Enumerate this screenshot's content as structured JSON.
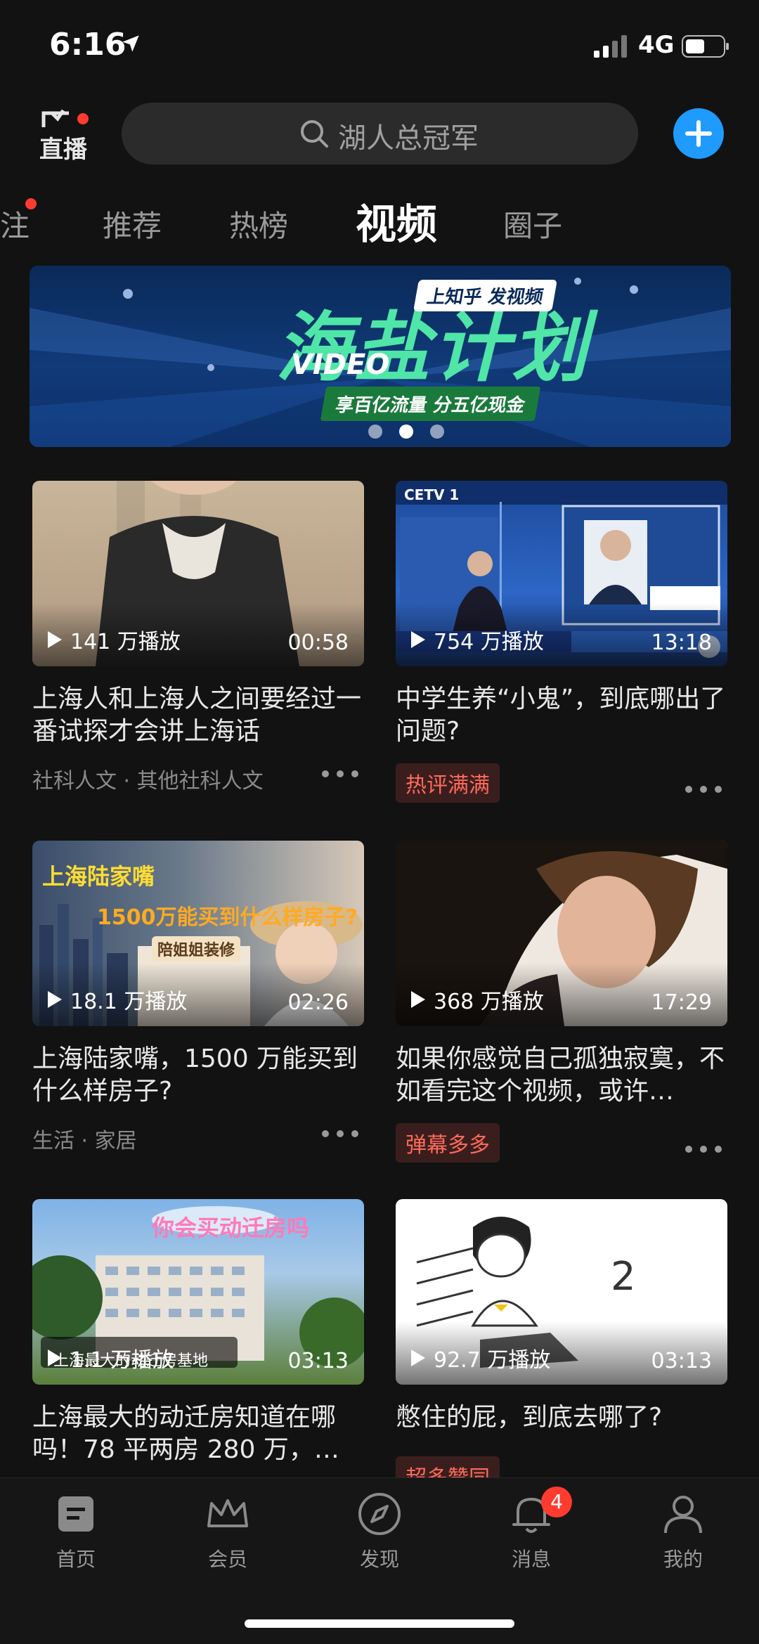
{
  "status_bar": {
    "time": "6:16",
    "network": "4G"
  },
  "header": {
    "live_label": "直播",
    "search_placeholder": "湖人总冠军"
  },
  "tabs": [
    {
      "label": "注",
      "dot": true
    },
    {
      "label": "推荐"
    },
    {
      "label": "热榜"
    },
    {
      "label": "视频",
      "active": true
    },
    {
      "label": "圈子"
    }
  ],
  "banner": {
    "title": "海盐计划",
    "video_text": "VIDEO",
    "tag": "上知乎 发视频",
    "subtitle": "享百亿流量  分五亿现金",
    "slide_index": 2,
    "slide_count": 3
  },
  "feed": [
    {
      "plays": "141 万播放",
      "duration": "00:58",
      "title": "上海人和上海人之间要经过一番试探才会讲上海话",
      "meta": "社科人文 · 其他社科人文"
    },
    {
      "plays": "754 万播放",
      "duration": "13:18",
      "title": "中学生养“小鬼”，到底哪出了问题?",
      "tag": "热评满满",
      "thumb_text": "CETV 1"
    },
    {
      "plays": "18.1 万播放",
      "duration": "02:26",
      "title": "上海陆家嘴，1500 万能买到什么样房子?",
      "meta": "生活 · 家居",
      "thumb_text": "上海陆家嘴",
      "thumb_text2": "1500万能买到什么样房子?",
      "thumb_text3": "陪姐姐装修"
    },
    {
      "plays": "368 万播放",
      "duration": "17:29",
      "title": "如果你感觉自己孤独寂寞，不如看完这个视频，或许…",
      "tag": "弹幕多多"
    },
    {
      "plays": "1.1 万播放",
      "duration": "03:13",
      "title": "上海最大的动迁房知道在哪吗！78 平两房 280 万，…",
      "thumb_text": "你会买动迁房吗",
      "thumb_text2": "上海最大的动迁房基地"
    },
    {
      "plays": "92.7 万播放",
      "duration": "03:13",
      "title": "憋住的屁，到底去哪了?",
      "tag": "超多赞同",
      "thumb_text": "2"
    }
  ],
  "bottom_nav": [
    {
      "label": "首页",
      "icon": "home-icon"
    },
    {
      "label": "会员",
      "icon": "crown-icon"
    },
    {
      "label": "发现",
      "icon": "compass-icon"
    },
    {
      "label": "消息",
      "icon": "bell-icon",
      "badge": "4"
    },
    {
      "label": "我的",
      "icon": "person-icon"
    }
  ]
}
